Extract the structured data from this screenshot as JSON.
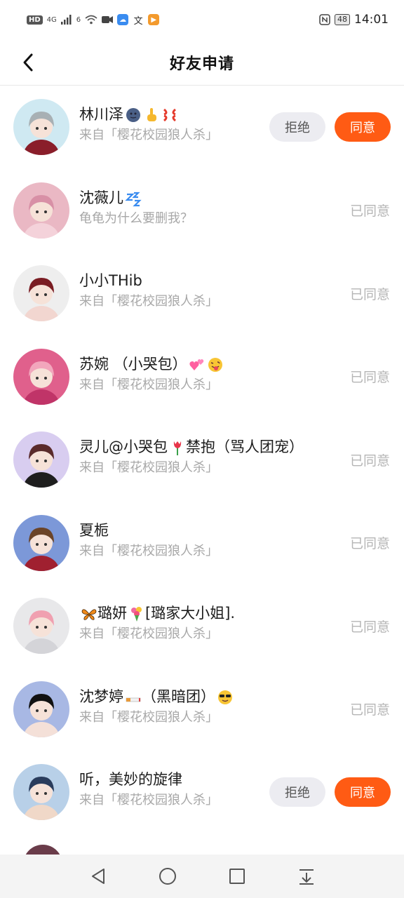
{
  "status_bar": {
    "left_badges": [
      "HD",
      "4G"
    ],
    "signal_label": "6",
    "time": "14:01",
    "battery": "48"
  },
  "header": {
    "title": "好友申请"
  },
  "buttons": {
    "reject": "拒绝",
    "accept": "同意",
    "accepted": "已同意"
  },
  "requests": [
    {
      "name": "林川泽",
      "emojis": [
        "moon-face-emoji",
        "pointing-hand-emoji",
        "anger-symbol-emoji"
      ],
      "sub": "来自「樱花校园狼人杀」",
      "state": "pending",
      "avatar_colors": [
        "#cfe9f2",
        "#a8b0b4",
        "#8a1e2a"
      ]
    },
    {
      "name": "沈薇儿",
      "emojis": [
        "zzz-emoji"
      ],
      "sub": "龟龟为什么要删我？",
      "state": "accepted",
      "avatar_colors": [
        "#eab8c4",
        "#d890a6",
        "#f4d2da"
      ]
    },
    {
      "name": "小小THib",
      "emojis": [],
      "sub": "来自「樱花校园狼人杀」",
      "state": "accepted",
      "avatar_colors": [
        "#eeeeee",
        "#7a1c22",
        "#f2d6d0"
      ]
    },
    {
      "name": "苏婉 （小哭包）",
      "emojis": [
        "two-hearts-emoji",
        "tongue-face-emoji"
      ],
      "sub": "来自「樱花校园狼人杀」",
      "state": "accepted",
      "avatar_colors": [
        "#e0608c",
        "#f2a6bc",
        "#c03468"
      ]
    },
    {
      "name": "灵儿@小哭包",
      "name_after": "禁抱（骂人团宠）",
      "emojis": [
        "tulip-emoji"
      ],
      "sub": "来自「樱花校园狼人杀」",
      "state": "accepted",
      "avatar_colors": [
        "#d8cdf0",
        "#5a2b2b",
        "#1e1e1e"
      ]
    },
    {
      "name": "夏栀",
      "emojis": [],
      "sub": "来自「樱花校园狼人杀」",
      "state": "accepted",
      "avatar_colors": [
        "#7c98d8",
        "#6b4428",
        "#a02030"
      ]
    },
    {
      "name": "璐妍",
      "name_prefix_emoji": "butterfly-emoji",
      "name_after": "[璐家大小姐].",
      "emojis": [
        "bouquet-emoji"
      ],
      "sub": "来自「樱花校园狼人杀」",
      "state": "accepted",
      "avatar_colors": [
        "#e8e8ea",
        "#f0a0b0",
        "#d4d4d8"
      ]
    },
    {
      "name": "沈梦婷",
      "name_after": "（黑暗团）",
      "emojis": [
        "cigarette-emoji",
        "sunglasses-face-emoji"
      ],
      "sub": "来自「樱花校园狼人杀」",
      "state": "accepted",
      "avatar_colors": [
        "#a8b8e4",
        "#111111",
        "#f4e0d8"
      ]
    },
    {
      "name": "听，美妙的旋律",
      "emojis": [],
      "sub": "来自「樱花校园狼人杀」",
      "state": "pending",
      "avatar_colors": [
        "#b8d0e8",
        "#2a3c5c",
        "#f0d8c8"
      ]
    }
  ],
  "nav": {
    "icons": [
      "back-triangle-icon",
      "home-circle-icon",
      "recents-square-icon",
      "notification-pull-icon"
    ]
  }
}
